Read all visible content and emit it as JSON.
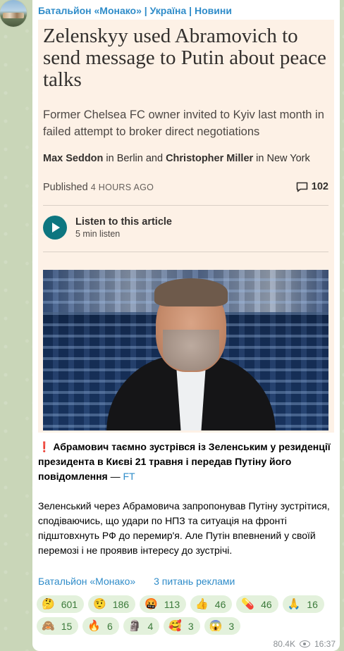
{
  "channel": {
    "name": "Батальйон «Монако» | Україна | Новини"
  },
  "preview": {
    "title": "Zelenskyy used Abramovich to send message to Putin about peace talks",
    "standfirst": "Former Chelsea FC owner invited to Kyiv last month in failed attempt to broker direct negotiations",
    "byline": {
      "author1": "Max Seddon",
      "in1": " in Berlin and ",
      "author2": "Christopher Miller",
      "in2": " in New York"
    },
    "published_label": "Published",
    "published_ago": "4 HOURS AGO",
    "comment_count": "102",
    "listen_title": "Listen to this article",
    "listen_duration": "5 min listen"
  },
  "message": {
    "excl": "❗",
    "headline": "Абрамович таємно зустрівся із Зеленським у резиденції президента в Києві 21 травня і передав Путіну його повідомлення",
    "dash": " — ",
    "source_link": "FT",
    "paragraph": "Зеленський через Абрамовича запропонував Путіну зустрітися, сподіваючись, що удари по НПЗ та ситуація на фронті підштовхнуть РФ до перемир'я. Але Путін впевнений у своїй перемозі і не проявив інтересу до зустрічі."
  },
  "footer": {
    "channel_link": "Батальйон «Монако»",
    "ads_link": "3 питань реклами"
  },
  "reactions": [
    {
      "emoji": "🤔",
      "count": "601"
    },
    {
      "emoji": "🤨",
      "count": "186"
    },
    {
      "emoji": "🤬",
      "count": "113"
    },
    {
      "emoji": "👍",
      "count": "46"
    },
    {
      "emoji": "💊",
      "count": "46"
    },
    {
      "emoji": "🙏",
      "count": "16"
    },
    {
      "emoji": "🙈",
      "count": "15"
    },
    {
      "emoji": "🔥",
      "count": "6"
    },
    {
      "emoji": "🗿",
      "count": "4"
    },
    {
      "emoji": "🥰",
      "count": "3"
    },
    {
      "emoji": "😱",
      "count": "3"
    }
  ],
  "meta": {
    "views": "80.4K",
    "time": "16:37"
  },
  "colors": {
    "link": "#2f8cc9",
    "ft_background": "#fdf1e6",
    "ft_teal": "#0d7680",
    "reaction_bg": "#e3f1dc"
  }
}
